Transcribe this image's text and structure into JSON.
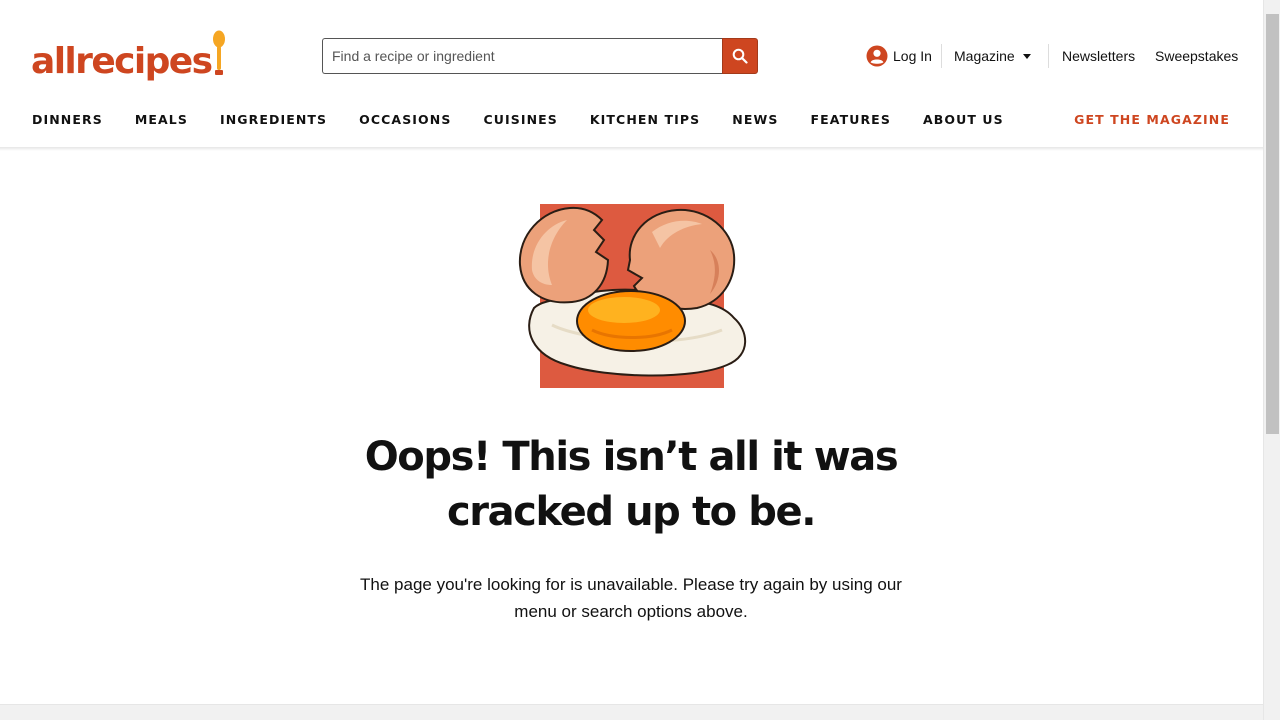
{
  "logo": {
    "text": "allrecipes"
  },
  "search": {
    "placeholder": "Find a recipe or ingredient"
  },
  "header_links": {
    "login": "Log In",
    "magazine": "Magazine",
    "newsletters": "Newsletters",
    "sweepstakes": "Sweepstakes"
  },
  "nav": {
    "items": [
      "DINNERS",
      "MEALS",
      "INGREDIENTS",
      "OCCASIONS",
      "CUISINES",
      "KITCHEN TIPS",
      "NEWS",
      "FEATURES",
      "ABOUT US"
    ],
    "cta": "GET THE MAGAZINE"
  },
  "error": {
    "heading_line1": "Oops! This isn’t all it was",
    "heading_line2": "cracked up to be.",
    "message": "The page you're looking for is unavailable. Please try again by using our menu or search options above."
  },
  "colors": {
    "brand": "#ce4620",
    "hero_bg": "#dd5a40",
    "yolk": "#ff8c00"
  },
  "icons": [
    "spoon-icon",
    "search-icon",
    "user-icon",
    "chevron-down-icon",
    "cracked-egg-illustration"
  ]
}
